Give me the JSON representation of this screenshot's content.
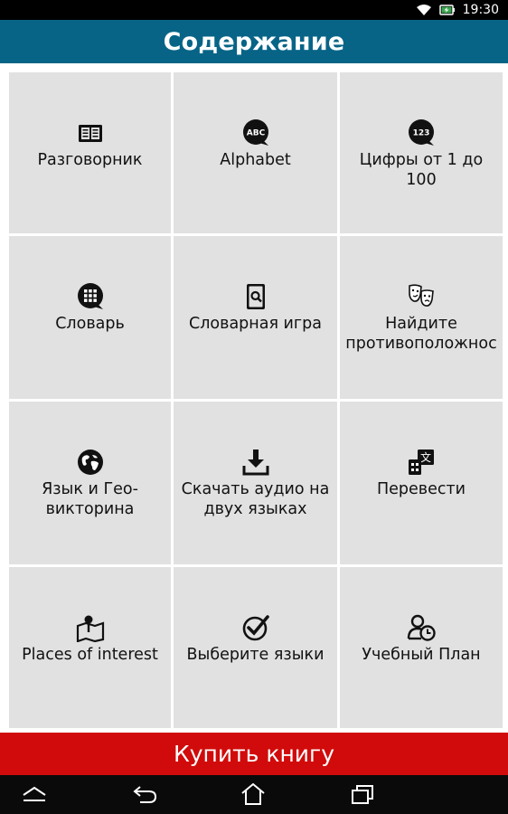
{
  "status_bar": {
    "time": "19:30",
    "icons": [
      "wifi-icon",
      "battery-charging-icon"
    ]
  },
  "header": {
    "title": "Содержание"
  },
  "menu": {
    "items": [
      {
        "label": "Разговорник",
        "icon": "book-icon"
      },
      {
        "label": "Alphabet",
        "icon": "abc-bubble-icon",
        "icon_text": "ABC"
      },
      {
        "label": "Цифры от 1 до\n100",
        "icon": "numbers-bubble-icon",
        "icon_text": "123"
      },
      {
        "label": "Словарь",
        "icon": "keypad-bubble-icon"
      },
      {
        "label": "Словарная игра",
        "icon": "card-game-icon"
      },
      {
        "label": "Найдите\nпротивоположнос",
        "icon": "theater-masks-icon"
      },
      {
        "label": "Язык и Гео-\nвикторина",
        "icon": "globe-icon"
      },
      {
        "label": "Скачать аудио на\nдвух языках",
        "icon": "download-icon"
      },
      {
        "label": "Перевести",
        "icon": "translate-icon"
      },
      {
        "label": "Places of interest",
        "icon": "map-pin-icon"
      },
      {
        "label": "Выберите языки",
        "icon": "checkmark-circle-icon"
      },
      {
        "label": "Учебный План",
        "icon": "user-clock-icon"
      }
    ]
  },
  "footer": {
    "buy_label": "Купить книгу"
  },
  "nav_bar": {
    "icons": [
      "menu-up-icon",
      "back-icon",
      "home-icon",
      "recent-apps-icon"
    ]
  },
  "colors": {
    "header_bg": "#076487",
    "tile_bg": "#e1e1e1",
    "buy_bg": "#d10b0b",
    "status_bg": "#000000"
  }
}
